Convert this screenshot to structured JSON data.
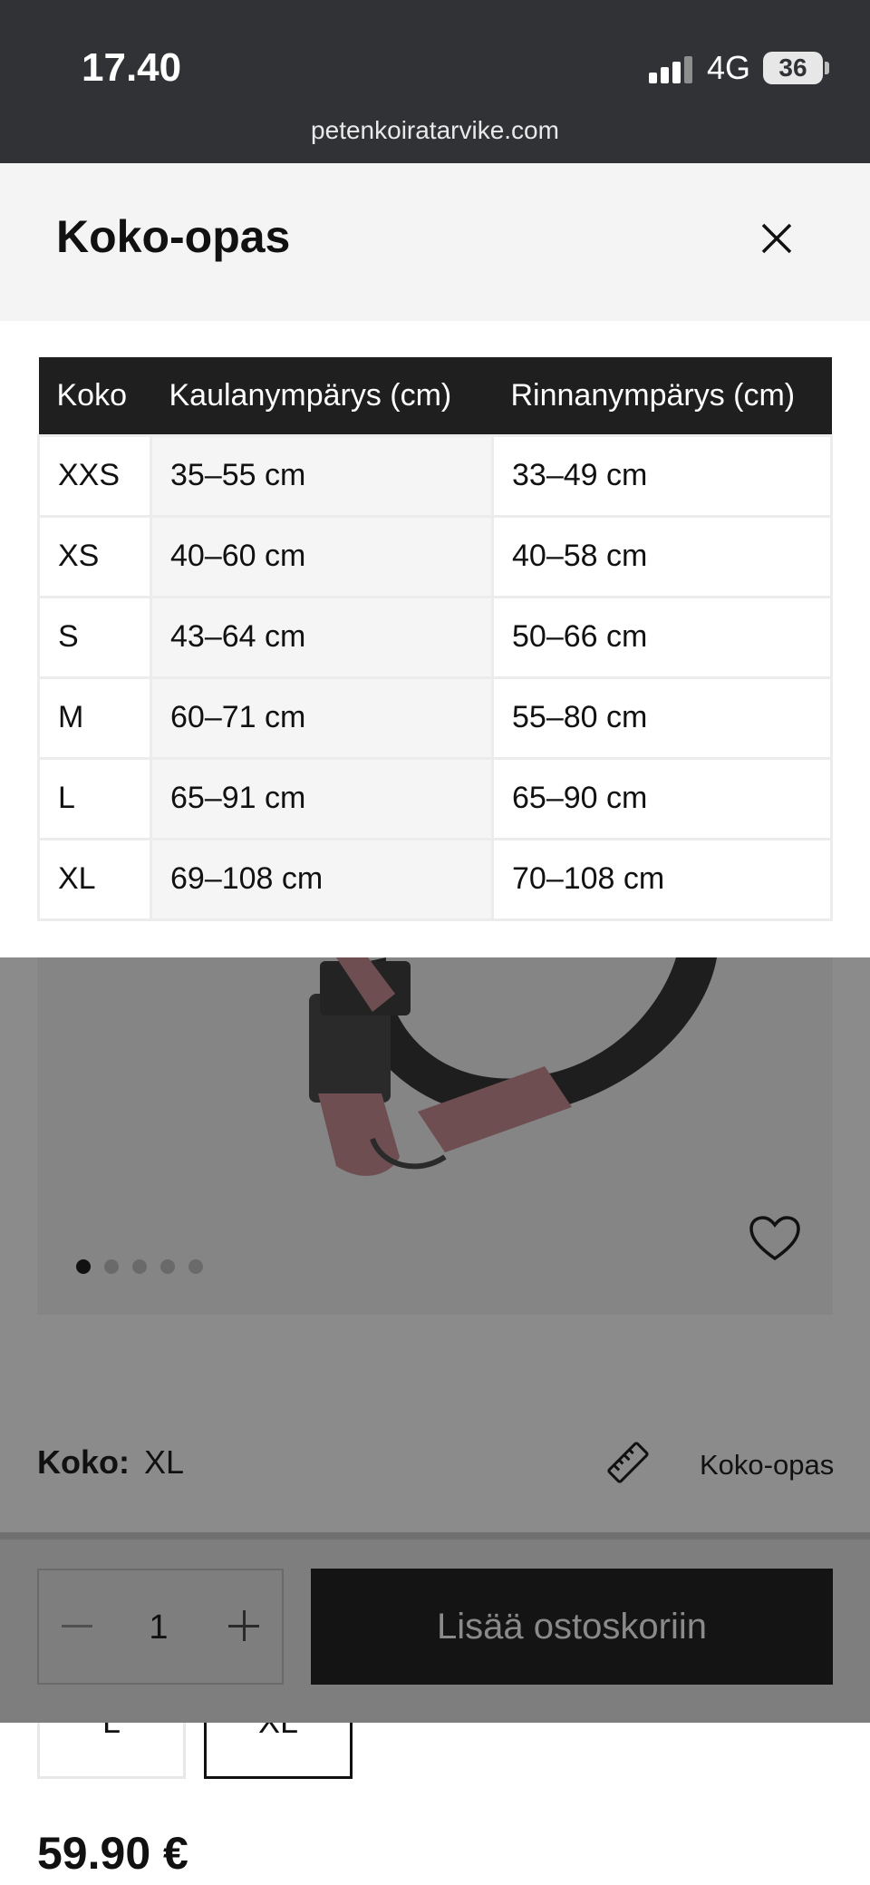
{
  "status_bar": {
    "time": "17.40",
    "network": "4G",
    "battery": "36",
    "url": "petenkoiratarvike.com"
  },
  "modal": {
    "title": "Koko-opas",
    "close_icon": "close-icon",
    "table": {
      "headers": [
        "Koko",
        "Kaulanympärys (cm)",
        "Rinnanympärys (cm)"
      ],
      "rows": [
        [
          "XXS",
          "35–55 cm",
          "33–49 cm"
        ],
        [
          "XS",
          "40–60 cm",
          "40–58 cm"
        ],
        [
          "S",
          "43–64 cm",
          "50–66 cm"
        ],
        [
          "M",
          "60–71 cm",
          "55–80 cm"
        ],
        [
          "L",
          "65–91 cm",
          "65–90 cm"
        ],
        [
          "XL",
          "69–108 cm",
          "70–108 cm"
        ]
      ]
    }
  },
  "product": {
    "carousel_total": 5,
    "carousel_active": 1,
    "size_label": "Koko:",
    "size_value": "XL",
    "guide_label": "Koko-opas",
    "quantity": "1",
    "add_to_cart": "Lisää ostoskoriin",
    "size_options": [
      "L",
      "XL"
    ],
    "selected_size": "XL",
    "price": "59.90 €"
  }
}
